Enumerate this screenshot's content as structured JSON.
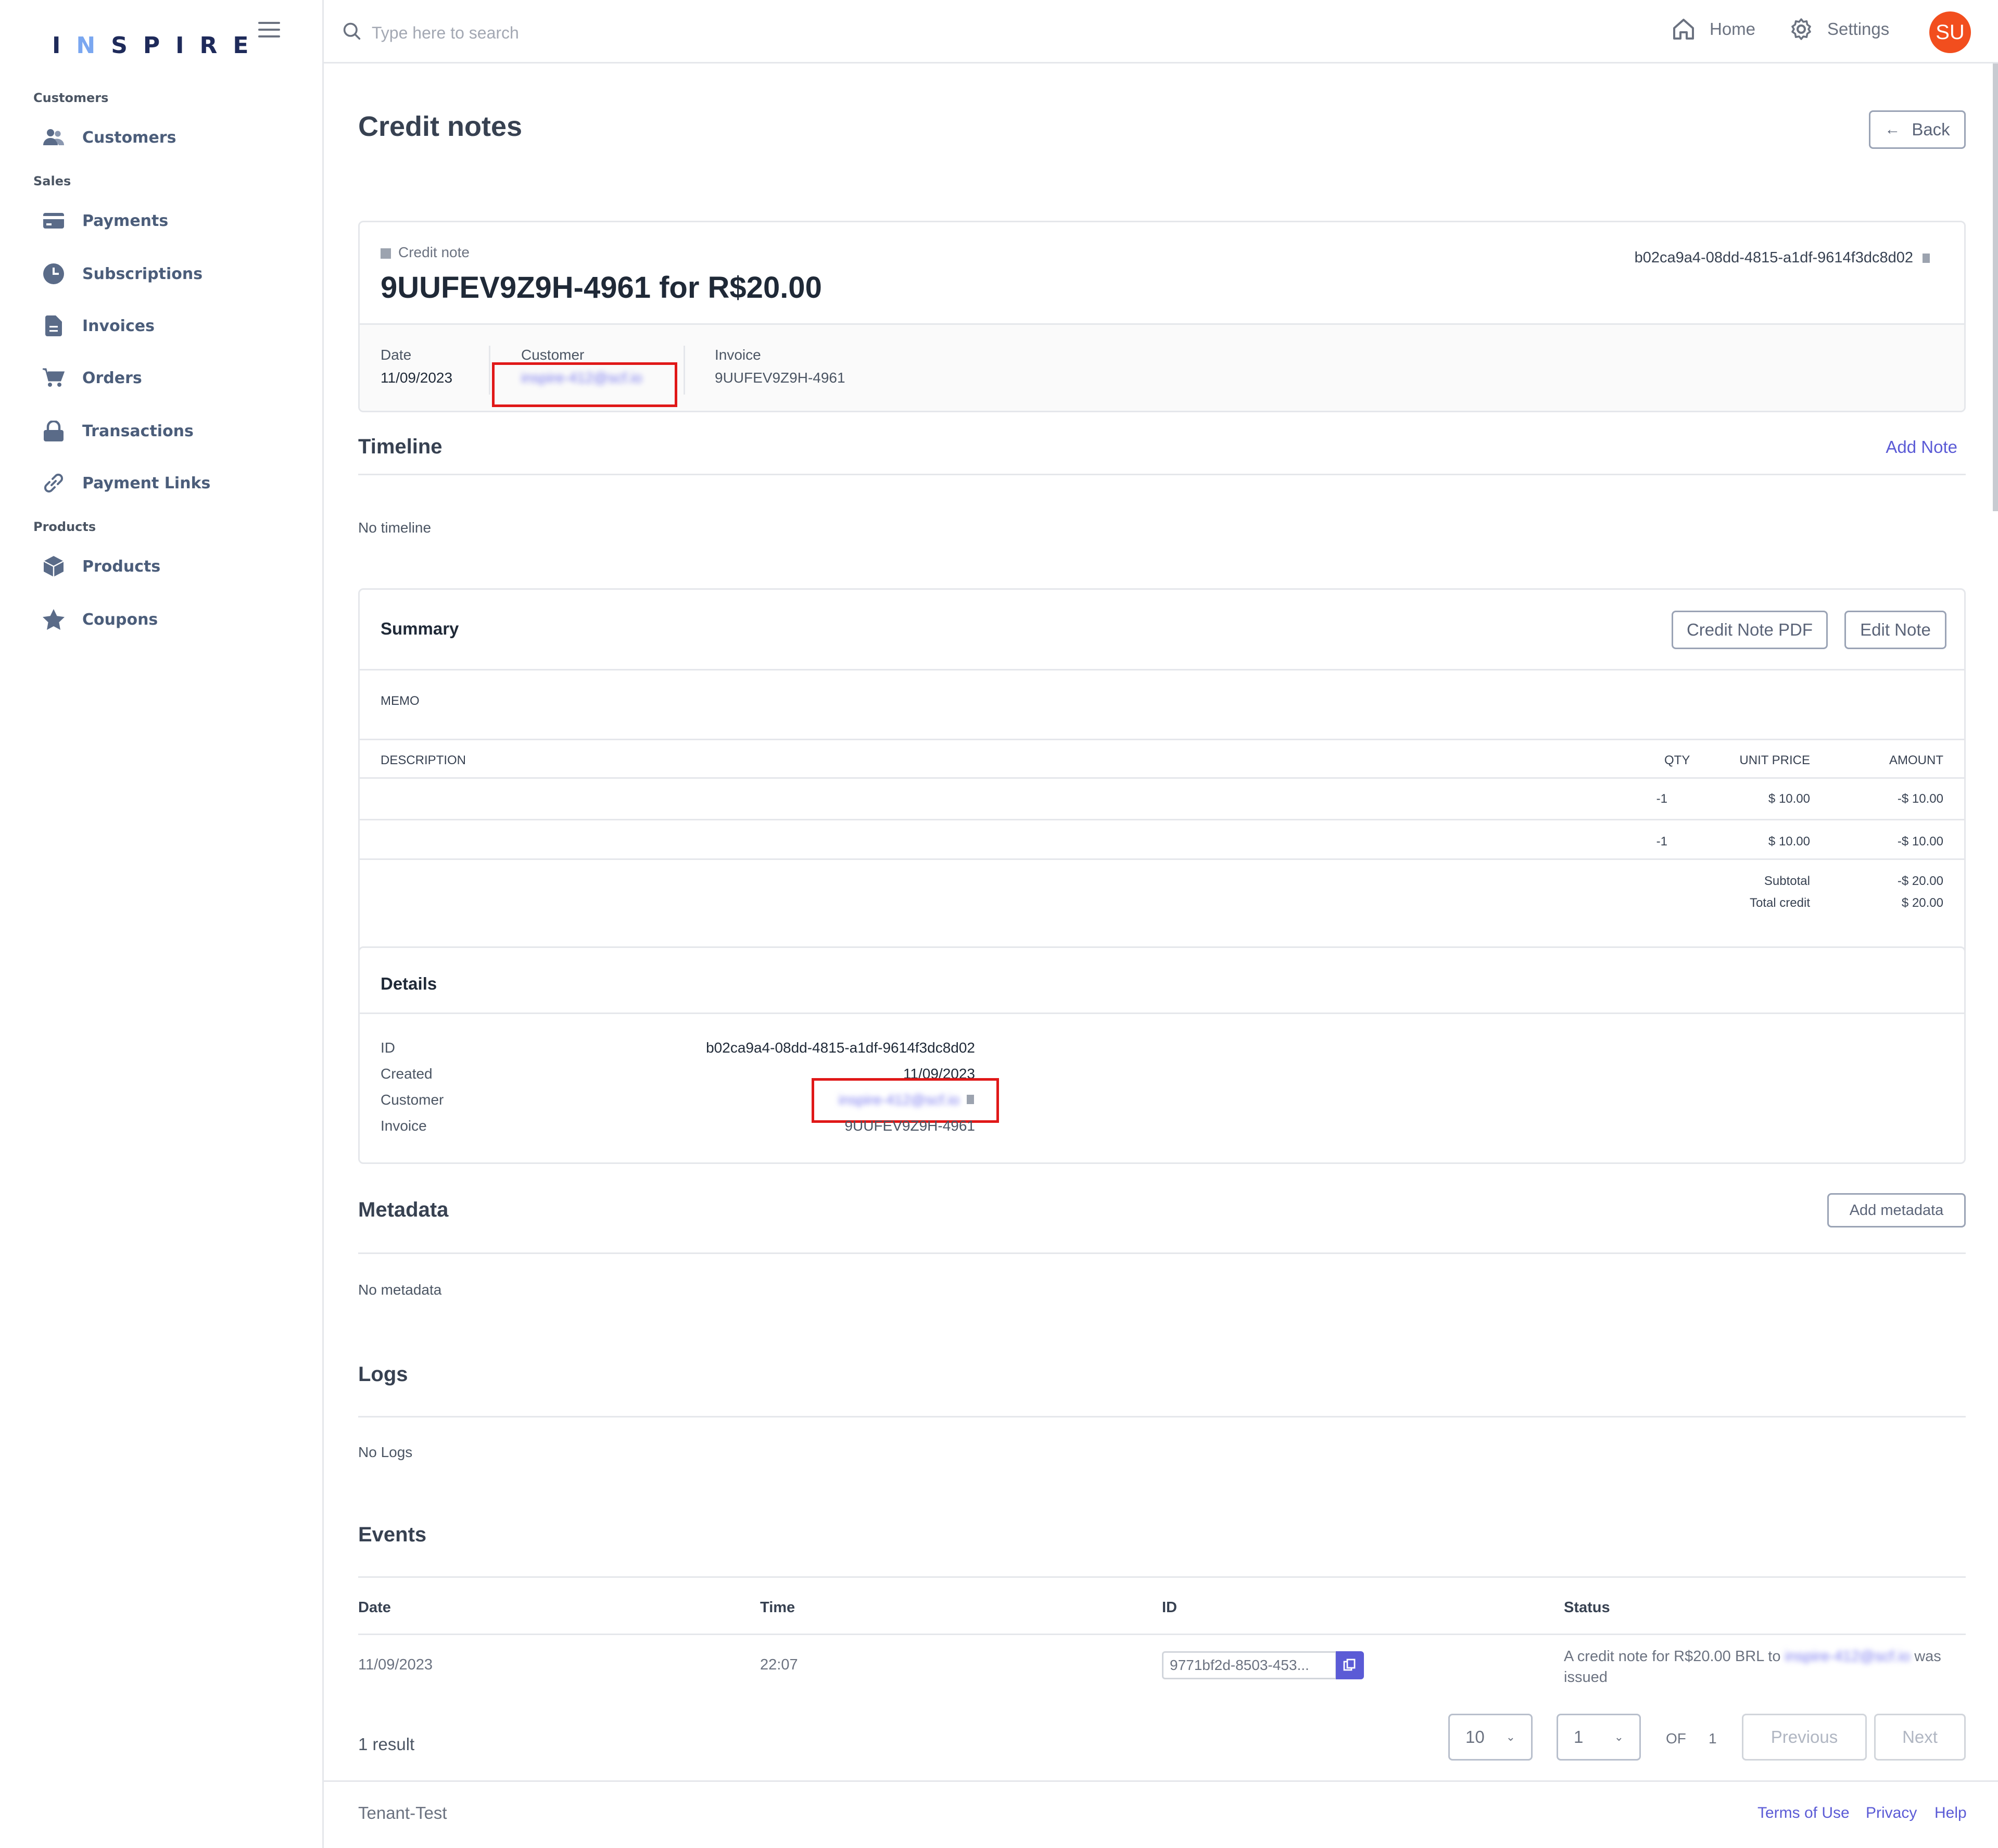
{
  "app": {
    "logo": "INSPIRE"
  },
  "sidebar": {
    "sections": [
      {
        "label": "Customers",
        "items": [
          {
            "label": "Customers",
            "icon": "users-icon"
          }
        ]
      },
      {
        "label": "Sales",
        "items": [
          {
            "label": "Payments",
            "icon": "credit-card-icon"
          },
          {
            "label": "Subscriptions",
            "icon": "clock-icon"
          },
          {
            "label": "Invoices",
            "icon": "document-icon"
          },
          {
            "label": "Orders",
            "icon": "cart-icon"
          },
          {
            "label": "Transactions",
            "icon": "lock-icon"
          },
          {
            "label": "Payment Links",
            "icon": "link-icon"
          }
        ]
      },
      {
        "label": "Products",
        "items": [
          {
            "label": "Products",
            "icon": "box-icon"
          },
          {
            "label": "Coupons",
            "icon": "star-icon"
          }
        ]
      }
    ]
  },
  "header": {
    "search_placeholder": "Type here to search",
    "home": "Home",
    "settings": "Settings",
    "avatar": "SU"
  },
  "page": {
    "title": "Credit notes",
    "back": "Back"
  },
  "credit_note": {
    "kind": "Credit note",
    "heading": "9UUFEV9Z9H-4961 for R$20.00",
    "id": "b02ca9a4-08dd-4815-a1df-9614f3dc8d02",
    "date_label": "Date",
    "date": "11/09/2023",
    "customer_label": "Customer",
    "customer_value": "inspire-412@scf.io",
    "invoice_label": "Invoice",
    "invoice": "9UUFEV9Z9H-4961"
  },
  "timeline": {
    "title": "Timeline",
    "add_note": "Add Note",
    "empty": "No timeline"
  },
  "summary": {
    "title": "Summary",
    "pdf_button": "Credit Note PDF",
    "edit_button": "Edit Note",
    "memo": "MEMO",
    "columns": {
      "description": "DESCRIPTION",
      "qty": "QTY",
      "unit_price": "UNIT PRICE",
      "amount": "AMOUNT"
    },
    "rows": [
      {
        "description": "",
        "qty": "-1",
        "unit_price": "$ 10.00",
        "amount": "-$ 10.00"
      },
      {
        "description": "",
        "qty": "-1",
        "unit_price": "$ 10.00",
        "amount": "-$ 10.00"
      }
    ],
    "subtotal_label": "Subtotal",
    "subtotal": "-$ 20.00",
    "total_label": "Total credit",
    "total": "$ 20.00"
  },
  "details": {
    "title": "Details",
    "id_label": "ID",
    "id": "b02ca9a4-08dd-4815-a1df-9614f3dc8d02",
    "created_label": "Created",
    "created": "11/09/2023",
    "customer_label": "Customer",
    "customer": "inspire-412@scf.io",
    "invoice_label": "Invoice",
    "invoice": "9UUFEV9Z9H-4961"
  },
  "metadata": {
    "title": "Metadata",
    "add": "Add metadata",
    "empty": "No metadata"
  },
  "logs": {
    "title": "Logs",
    "empty": "No Logs"
  },
  "events": {
    "title": "Events",
    "columns": {
      "date": "Date",
      "time": "Time",
      "id": "ID",
      "status": "Status"
    },
    "rows": [
      {
        "date": "11/09/2023",
        "time": "22:07",
        "id": "9771bf2d-8503-453...",
        "status_prefix": "A credit note for R$20.00 BRL to",
        "status_customer": "inspire-412@scf.io",
        "status_suffix1": "was",
        "status_suffix2": "issued"
      }
    ],
    "result_count": "1 result",
    "page_size": "10",
    "page": "1",
    "of": "OF",
    "total_pages": "1",
    "previous": "Previous",
    "next": "Next"
  },
  "footer": {
    "tenant": "Tenant-Test",
    "terms": "Terms of Use",
    "privacy": "Privacy",
    "help": "Help"
  }
}
